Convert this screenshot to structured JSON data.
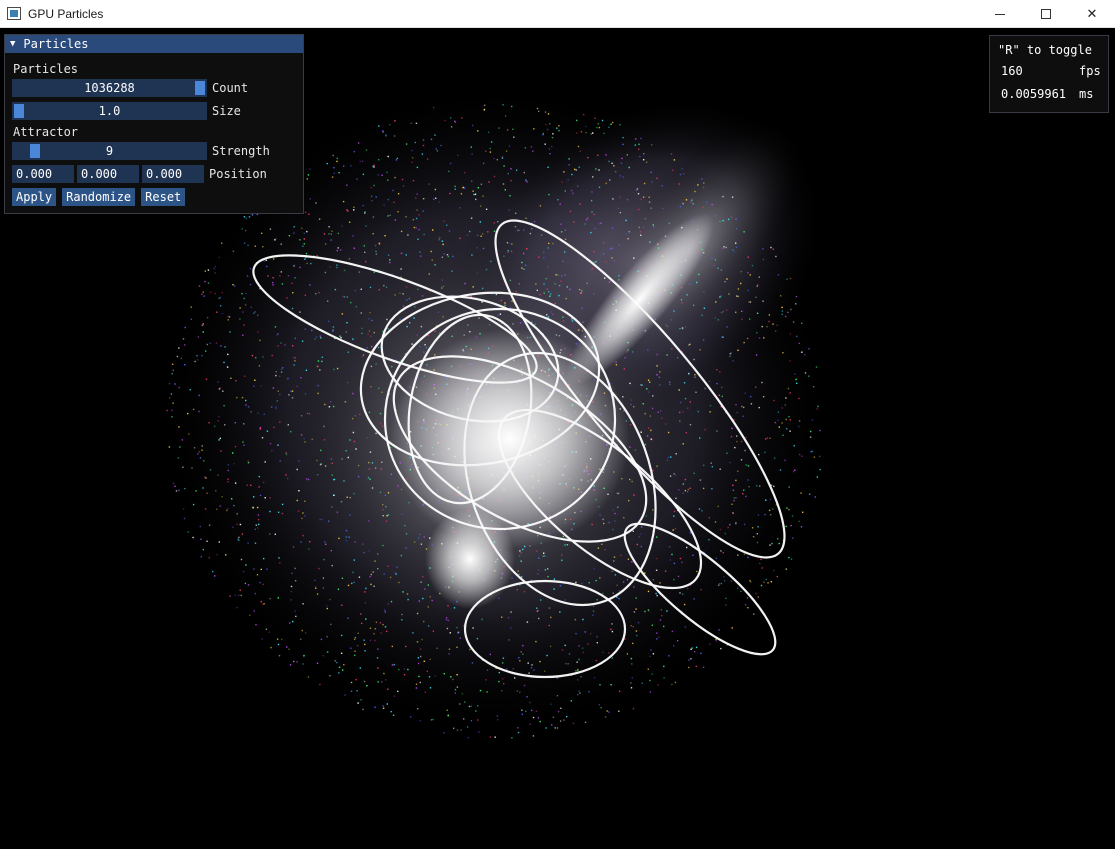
{
  "window": {
    "title": "GPU Particles"
  },
  "panel": {
    "title": "Particles",
    "sections": {
      "particles": "Particles",
      "attractor": "Attractor"
    },
    "count": {
      "value": "1036288",
      "label": "Count",
      "fraction": 0.97
    },
    "size": {
      "value": "1.0",
      "label": "Size",
      "fraction": 0.0
    },
    "strength": {
      "value": "9",
      "label": "Strength",
      "fraction": 0.09
    },
    "position": {
      "x": "0.000",
      "y": "0.000",
      "z": "0.000",
      "label": "Position"
    },
    "buttons": {
      "apply": "Apply",
      "randomize": "Randomize",
      "reset": "Reset"
    }
  },
  "stats": {
    "hint": "\"R\" to toggle",
    "fps_value": "160",
    "fps_unit": "fps",
    "ms_value": "0.0059961",
    "ms_unit": "ms"
  },
  "colors": {
    "accent": "#4a87d8",
    "slider_bg": "#1f3352",
    "header": "#2a4a7c"
  },
  "icons": {
    "app": "app-window-icon",
    "minimize": "minimize-icon",
    "maximize": "maximize-icon",
    "close": "close-icon",
    "collapse": "collapse-triangle-icon"
  }
}
